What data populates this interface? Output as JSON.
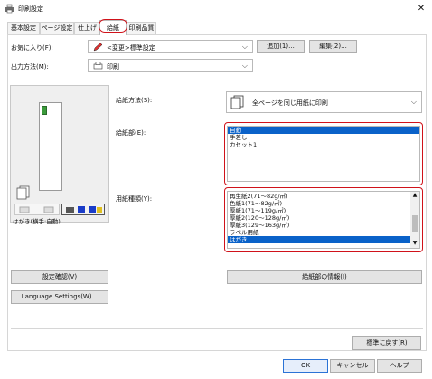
{
  "window": {
    "title": "印刷設定",
    "close_label": "✕"
  },
  "tabs": [
    {
      "label": "基本設定"
    },
    {
      "label": "ページ設定"
    },
    {
      "label": "仕上げ"
    },
    {
      "label": "給紙",
      "active": true
    },
    {
      "label": "印刷品質"
    }
  ],
  "favorites": {
    "label": "お気に入り(F):",
    "value": "<変更>標準設定",
    "add_button": "追加(1)...",
    "edit_button": "編集(2)..."
  },
  "output_method": {
    "label": "出力方法(M):",
    "value": "印刷"
  },
  "feed_method": {
    "label": "給紙方法(S):",
    "value": "全ページを同じ用紙に印刷"
  },
  "paper_source": {
    "label": "給紙部(E):",
    "items": [
      "自動",
      "手差し",
      "カセット1"
    ],
    "selected_index": 0
  },
  "paper_type": {
    "label": "用紙種類(Y):",
    "items": [
      "再生紙2(71〜82g/㎡)",
      "色紙1(71〜82g/㎡)",
      "厚紙1(71〜119g/㎡)",
      "厚紙2(120〜128g/㎡)",
      "厚紙3(129〜163g/㎡)",
      "ラベル用紙",
      "はがき"
    ],
    "selected_index": 6
  },
  "preview": {
    "caption": "はがき(横手:自動)"
  },
  "buttons": {
    "confirm_settings": "設定確認(V)",
    "paper_source_info": "給紙部の情報(I)",
    "language_settings": "Language Settings(W)...",
    "restore_defaults": "標準に戻す(R)",
    "ok": "OK",
    "cancel": "キャンセル",
    "help": "ヘルプ"
  },
  "colors": {
    "accent_red": "#d0121a",
    "selection_blue": "#0a62c9"
  }
}
